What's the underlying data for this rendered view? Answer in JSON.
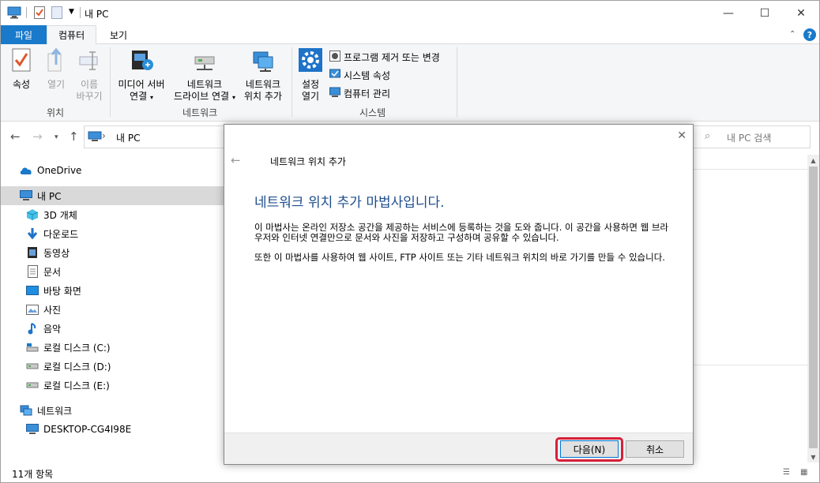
{
  "window": {
    "title": "내 PC",
    "controls": {
      "minimize": "—",
      "maximize": "☐",
      "close": "✕"
    }
  },
  "ribbon": {
    "tabs": {
      "file": "파일",
      "computer": "컴퓨터",
      "view": "보기"
    },
    "help": "?",
    "groups": {
      "location": {
        "label": "위치",
        "properties": "속성",
        "open": "열기",
        "rename_line1": "이름",
        "rename_line2": "바꾸기"
      },
      "network": {
        "label": "네트워크",
        "media_line1": "미디어 서버",
        "media_line2": "연결",
        "map_drive_line1": "네트워크",
        "map_drive_line2": "드라이브 연결",
        "add_location_line1": "네트워크",
        "add_location_line2": "위치 추가"
      },
      "system": {
        "label": "시스템",
        "open_settings_line1": "설정",
        "open_settings_line2": "열기",
        "uninstall": "프로그램 제거 또는 변경",
        "system_properties": "시스템 속성",
        "manage": "컴퓨터 관리"
      }
    }
  },
  "address": {
    "path": "내 PC",
    "separator": "›"
  },
  "search": {
    "placeholder": "내 PC 검색"
  },
  "navpane": {
    "items": [
      {
        "label": "OneDrive",
        "icon": "onedrive-icon"
      },
      {
        "label": "내 PC",
        "icon": "pc-icon",
        "selected": true
      },
      {
        "label": "3D 개체",
        "icon": "3d-objects-icon"
      },
      {
        "label": "다운로드",
        "icon": "download-icon"
      },
      {
        "label": "동영상",
        "icon": "video-icon"
      },
      {
        "label": "문서",
        "icon": "document-icon"
      },
      {
        "label": "바탕 화면",
        "icon": "desktop-icon"
      },
      {
        "label": "사진",
        "icon": "picture-icon"
      },
      {
        "label": "음악",
        "icon": "music-icon"
      },
      {
        "label": "로컬 디스크 (C:)",
        "icon": "drive-c-icon"
      },
      {
        "label": "로컬 디스크 (D:)",
        "icon": "drive-icon"
      },
      {
        "label": "로컬 디스크 (E:)",
        "icon": "drive-icon"
      },
      {
        "label": "네트워크",
        "icon": "network-icon"
      },
      {
        "label": "DESKTOP-CG4I98E",
        "icon": "computer-icon"
      }
    ]
  },
  "status": {
    "item_count": "11개 항목"
  },
  "dialog": {
    "title": "네트워크 위치 추가",
    "heading": "네트워크 위치 추가 마법사입니다.",
    "paragraph1": "이 마법사는 온라인 저장소 공간을 제공하는 서비스에 등록하는 것을 도와 줍니다. 이 공간을 사용하면 웹 브라우저와 인터넷 연결만으로 문서와 사진을 저장하고 구성하며 공유할 수 있습니다.",
    "paragraph2": "또한 이 마법사를 사용하여 웹 사이트, FTP 사이트 또는 기타 네트워크 위치의 바로 가기를 만들 수 있습니다.",
    "next_label": "다음(N)",
    "cancel_label": "취소",
    "close": "✕",
    "back": "←"
  },
  "colors": {
    "accent": "#1979ca",
    "heading": "#1e4e8c",
    "highlight": "#d6203a"
  }
}
